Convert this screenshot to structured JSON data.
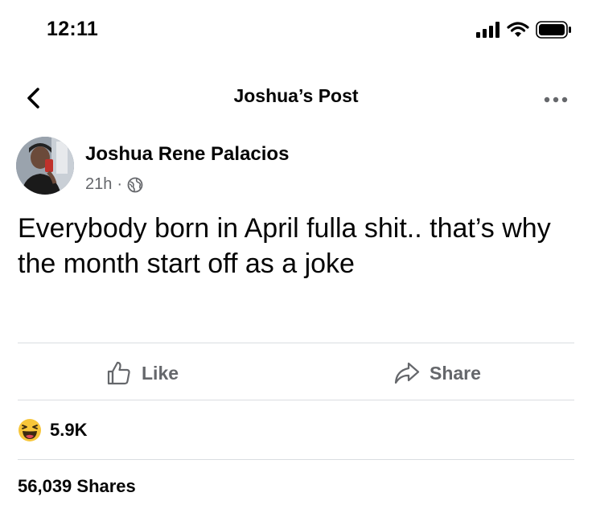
{
  "status_bar": {
    "time": "12:11"
  },
  "header": {
    "title": "Joshua’s Post"
  },
  "post": {
    "author": "Joshua Rene Palacios",
    "time_ago": "21h",
    "separator": "·",
    "audience_icon": "globe-icon",
    "text": "Everybody born in April fulla shit.. that’s why the month start off as a joke"
  },
  "actions": {
    "like_label": "Like",
    "share_label": "Share"
  },
  "reactions": {
    "icon": "haha-emoji-icon",
    "count": "5.9K"
  },
  "shares": {
    "label": "56,039 Shares"
  },
  "colors": {
    "text_primary": "#050505",
    "text_secondary": "#65676b",
    "divider": "#dadde1",
    "haha_yellow": "#f7c63a"
  }
}
